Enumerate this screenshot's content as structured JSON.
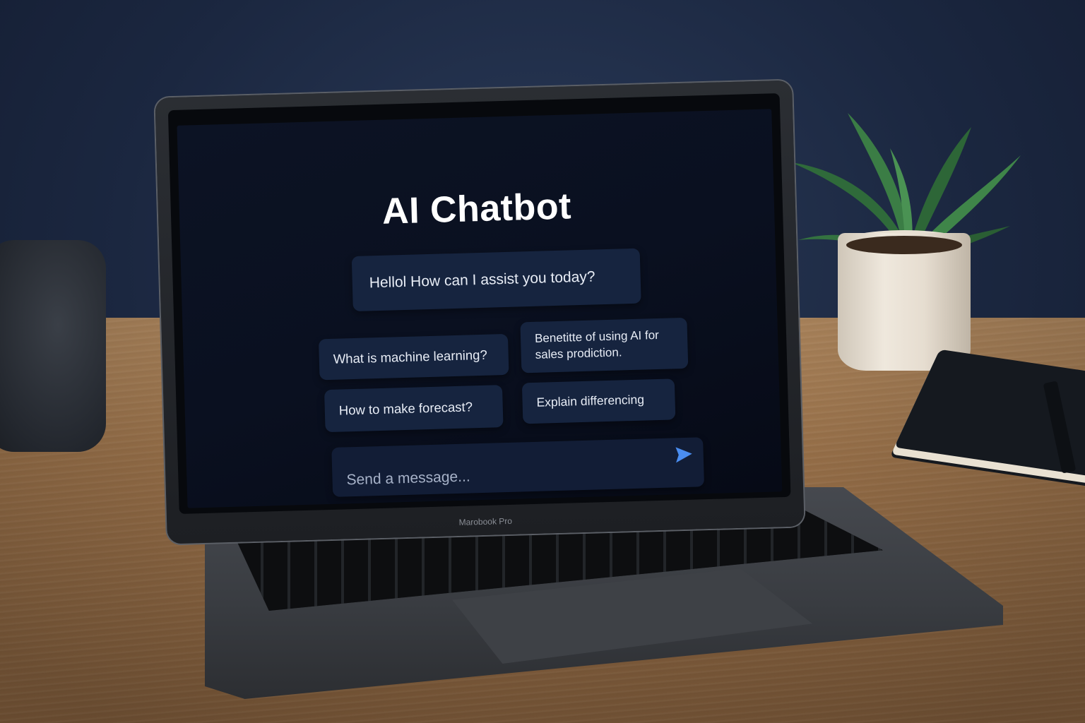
{
  "app": {
    "title": "AI Chatbot"
  },
  "chat": {
    "greeting": "Hellol How can I assist you today?"
  },
  "suggestions": [
    {
      "label": "What is machine learning?"
    },
    {
      "label": "Benetitte of using AI for sales prodiction."
    },
    {
      "label": "How to make forecast?"
    },
    {
      "label": "Explain differencing"
    }
  ],
  "composer": {
    "placeholder": "Send a message...",
    "send_icon": "send-icon"
  },
  "device": {
    "brand": "Marobook Pro"
  },
  "colors": {
    "screen_bg": "#0a1020",
    "bubble_bg": "#16243f",
    "send_accent": "#4a8df0"
  }
}
